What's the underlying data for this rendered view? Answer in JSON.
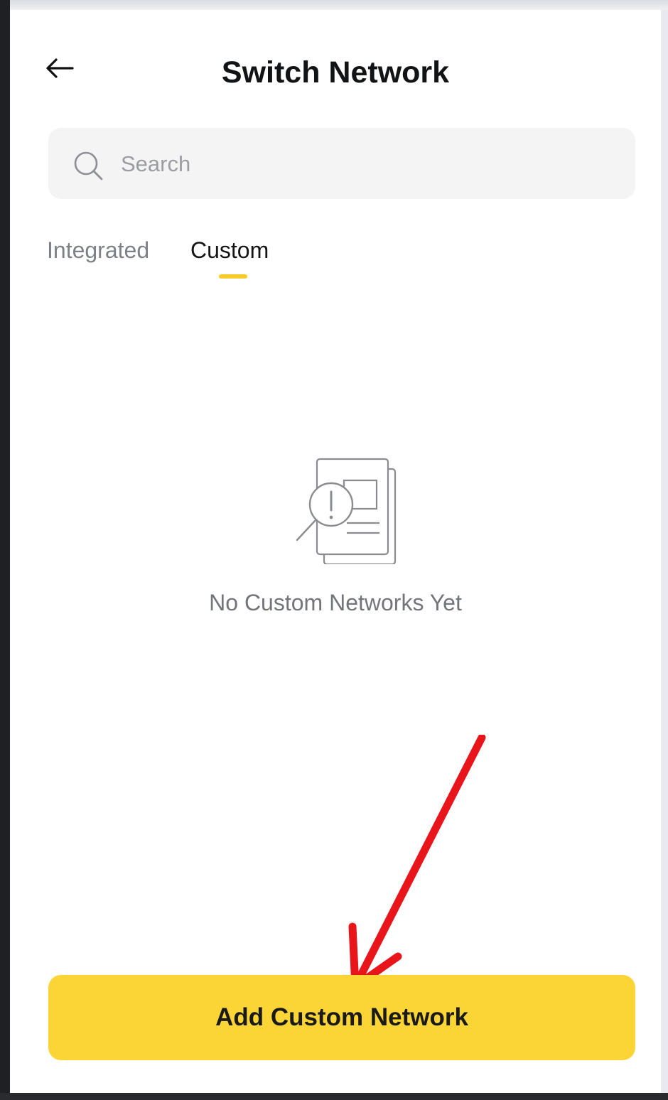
{
  "header": {
    "title": "Switch Network",
    "back_icon": "arrow-left-icon"
  },
  "search": {
    "placeholder": "Search",
    "value": "",
    "icon": "search-icon"
  },
  "tabs": [
    {
      "label": "Integrated",
      "active": false
    },
    {
      "label": "Custom",
      "active": true
    }
  ],
  "empty_state": {
    "icon": "document-search-warning-icon",
    "message": "No Custom Networks Yet"
  },
  "footer": {
    "add_button_label": "Add Custom Network"
  },
  "colors": {
    "accent": "#fbd535",
    "tab_indicator": "#f5cc2b",
    "annotation": "#e8151b",
    "muted_text": "#7e8087",
    "title_text": "#121314"
  }
}
